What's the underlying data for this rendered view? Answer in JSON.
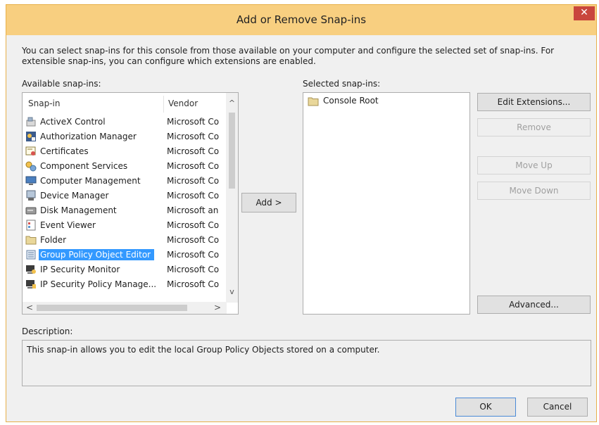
{
  "window": {
    "title": "Add or Remove Snap-ins",
    "close_glyph": "✕"
  },
  "intro_text": "You can select snap-ins for this console from those available on your computer and configure the selected set of snap-ins. For extensible snap-ins, you can configure which extensions are enabled.",
  "available": {
    "label": "Available snap-ins:",
    "columns": [
      "Snap-in",
      "Vendor"
    ],
    "rows": [
      {
        "name": "ActiveX Control",
        "vendor": "Microsoft Co",
        "icon": "activex-icon"
      },
      {
        "name": "Authorization Manager",
        "vendor": "Microsoft Co",
        "icon": "authorization-icon"
      },
      {
        "name": "Certificates",
        "vendor": "Microsoft Co",
        "icon": "certificate-icon"
      },
      {
        "name": "Component Services",
        "vendor": "Microsoft Co",
        "icon": "component-icon"
      },
      {
        "name": "Computer Management",
        "vendor": "Microsoft Co",
        "icon": "computer-icon"
      },
      {
        "name": "Device Manager",
        "vendor": "Microsoft Co",
        "icon": "device-icon"
      },
      {
        "name": "Disk Management",
        "vendor": "Microsoft an",
        "icon": "disk-icon"
      },
      {
        "name": "Event Viewer",
        "vendor": "Microsoft Co",
        "icon": "event-icon"
      },
      {
        "name": "Folder",
        "vendor": "Microsoft Co",
        "icon": "folder-icon"
      },
      {
        "name": "Group Policy Object Editor",
        "vendor": "Microsoft Co",
        "icon": "policy-icon"
      },
      {
        "name": "IP Security Monitor",
        "vendor": "Microsoft Co",
        "icon": "security-monitor-icon"
      },
      {
        "name": "IP Security Policy Manage...",
        "vendor": "Microsoft Co",
        "icon": "security-policy-icon"
      }
    ],
    "selected_index": 9
  },
  "add_button": "Add >",
  "selected": {
    "label": "Selected snap-ins:",
    "items": [
      "Console Root"
    ]
  },
  "buttons": {
    "edit_extensions": "Edit Extensions...",
    "remove": "Remove",
    "move_up": "Move Up",
    "move_down": "Move Down",
    "advanced": "Advanced...",
    "ok": "OK",
    "cancel": "Cancel"
  },
  "description": {
    "label": "Description:",
    "text": "This snap-in allows you to edit the local Group Policy Objects stored on a computer."
  },
  "scroll_glyphs": {
    "up": "^",
    "down": "v",
    "left": "<",
    "right": ">"
  }
}
